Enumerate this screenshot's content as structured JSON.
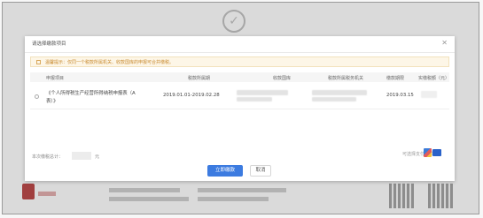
{
  "dialog": {
    "title": "请选择缴款项目",
    "notice": "温馨提示：仅同一个税款所属机关、收款国库的申报可合并缴税。"
  },
  "table": {
    "headers": [
      "申报项目",
      "税款所属期",
      "收款国库",
      "税款所属税务机关",
      "缴款期限",
      "实缴税额（元）"
    ],
    "rows": [
      {
        "item_line1": "《个人所得税生产经营所得纳税申报表（A",
        "item_line2": "表）》",
        "period": "2019.01.01-2019.02.28",
        "deadline": "2019.03.15"
      }
    ]
  },
  "footer": {
    "total_label": "本次缴税总计：",
    "unit": "元",
    "pay_label": "可选择支付方式："
  },
  "buttons": {
    "pay": "立即缴款",
    "cancel": "取消"
  },
  "icons": [
    "check-circle-icon",
    "close-icon",
    "radio-icon",
    "pay-method-icon",
    "unionpay-card-icon"
  ]
}
